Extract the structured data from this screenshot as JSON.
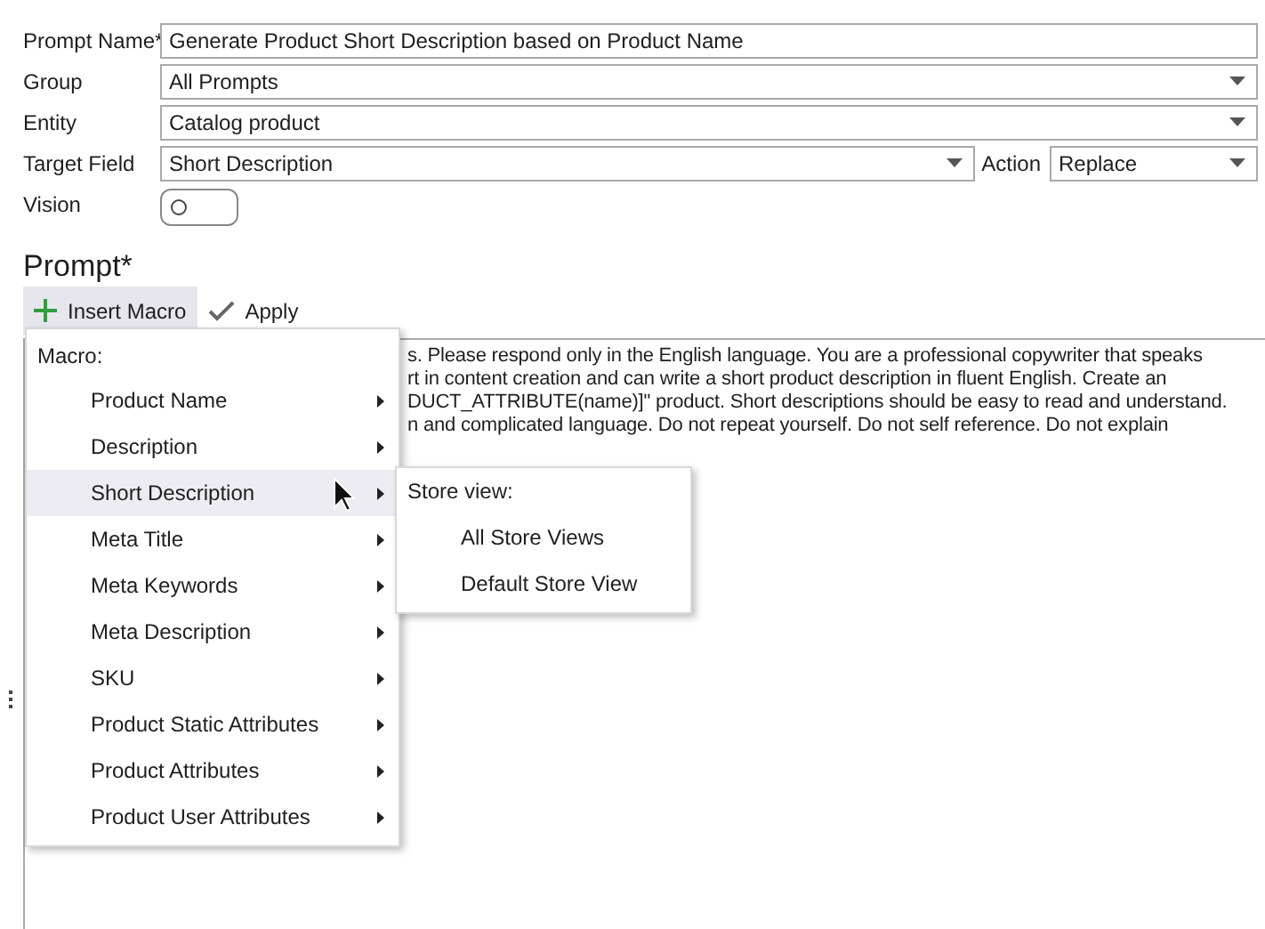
{
  "fields": [
    {
      "label": "Prompt Name*",
      "kind": "text",
      "value": "Generate Product Short Description based on Product Name"
    },
    {
      "label": "Group",
      "kind": "combo",
      "value": "All Prompts"
    },
    {
      "label": "Entity",
      "kind": "combo",
      "value": "Catalog product"
    },
    {
      "label": "Target Field",
      "kind": "combo",
      "value": "Short Description",
      "action": {
        "label": "Action",
        "value": "Replace"
      }
    },
    {
      "label": "Vision",
      "kind": "toggle",
      "on": false
    }
  ],
  "prompt": {
    "title": "Prompt*",
    "toolbar": [
      {
        "label": "Insert Macro",
        "pressed": true
      },
      {
        "label": "Apply",
        "pressed": false
      }
    ],
    "text_lines": [
      "s. Please respond only in the English language. You are a professional copywriter that speaks",
      "rt in content creation and can write a short product description in fluent English. Create an",
      "DUCT_ATTRIBUTE(name)]\" product. Short descriptions should be easy to read and understand.",
      "n and complicated language. Do not repeat yourself. Do not self reference. Do not explain"
    ]
  },
  "macro_menu": {
    "header": "Macro:",
    "items": [
      {
        "label": "Product Name",
        "selected": false
      },
      {
        "label": "Description",
        "selected": false
      },
      {
        "label": "Short Description",
        "selected": true
      },
      {
        "label": "Meta Title",
        "selected": false
      },
      {
        "label": "Meta Keywords",
        "selected": false
      },
      {
        "label": "Meta Description",
        "selected": false
      },
      {
        "label": "SKU",
        "selected": false
      },
      {
        "label": "Product Static Attributes",
        "selected": false
      },
      {
        "label": "Product Attributes",
        "selected": false
      },
      {
        "label": "Product User Attributes",
        "selected": false
      }
    ]
  },
  "submenu": {
    "header": "Store view:",
    "items": [
      "All Store Views",
      "Default Store View"
    ]
  }
}
